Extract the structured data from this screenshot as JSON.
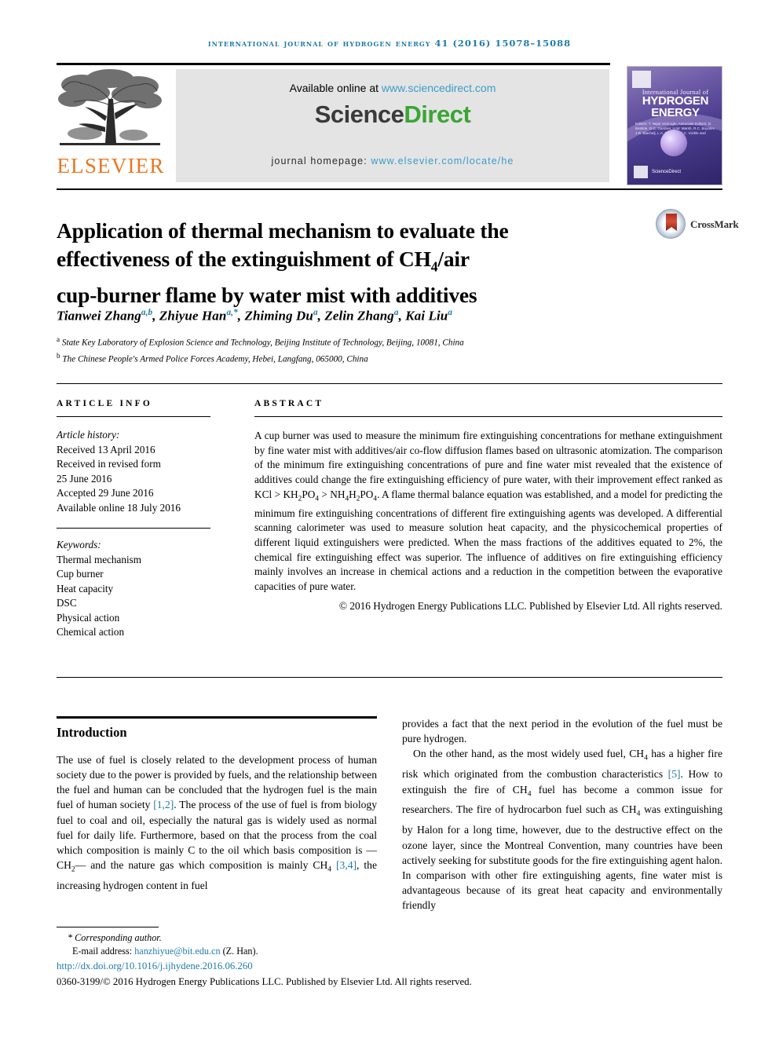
{
  "running_head": "International Journal of Hydrogen Energy 41 (2016) 15078–15088",
  "masthead": {
    "publisher": "ELSEVIER",
    "available_prefix": "Available online at ",
    "available_url": "www.sciencedirect.com",
    "logo_part1": "Science",
    "logo_part2": "Direct",
    "homepage_label": "journal homepage: ",
    "homepage_url": "www.elsevier.com/locate/he",
    "cover": {
      "line1": "International Journal of",
      "line2": "HYDROGEN ENERGY",
      "editors": "Editors: T. Nejat Veziroglu, Associate Editors: D. Bestide, D.C. Gardner, H.W. Marsh, R.C. Boyalev, J.R. Blachelj, L.A. Tho, T. and C. Vizikle and",
      "sciencedirect": "ScienceDirect"
    }
  },
  "article": {
    "title_line1": "Application of thermal mechanism to evaluate the",
    "title_line2_a": "effectiveness of the extinguishment of CH",
    "title_line2_sub": "4",
    "title_line2_b": "/air",
    "title_line3": "cup-burner flame by water mist with additives",
    "crossmark_label": "CrossMark",
    "authors": [
      {
        "name": "Tianwei Zhang",
        "marks": "a,b"
      },
      {
        "name": "Zhiyue Han",
        "marks": "a,*"
      },
      {
        "name": "Zhiming Du",
        "marks": "a"
      },
      {
        "name": "Zelin Zhang",
        "marks": "a"
      },
      {
        "name": "Kai Liu",
        "marks": "a"
      }
    ],
    "affiliations": [
      {
        "mark": "a",
        "text": "State Key Laboratory of Explosion Science and Technology, Beijing Institute of Technology, Beijing, 10081, China"
      },
      {
        "mark": "b",
        "text": "The Chinese People's Armed Police Forces Academy, Hebei, Langfang, 065000, China"
      }
    ]
  },
  "article_info": {
    "heading": "ARTICLE INFO",
    "history_label": "Article history:",
    "history": [
      "Received 13 April 2016",
      "Received in revised form",
      "25 June 2016",
      "Accepted 29 June 2016",
      "Available online 18 July 2016"
    ],
    "keywords_label": "Keywords:",
    "keywords": [
      "Thermal mechanism",
      "Cup burner",
      "Heat capacity",
      "DSC",
      "Physical action",
      "Chemical action"
    ]
  },
  "abstract": {
    "heading": "ABSTRACT",
    "part1": "A cup burner was used to measure the minimum fire extinguishing concentrations for methane extinguishment by fine water mist with additives/air co-flow diffusion flames based on ultrasonic atomization. The comparison of the minimum fire extinguishing concentrations of pure and fine water mist revealed that the existence of additives could change the fire extinguishing efficiency of pure water, with their improvement effect ranked as KCl > KH",
    "f1_sub": "2",
    "part2": "PO",
    "f2_sub": "4",
    "part3": " > NH",
    "f3_sub": "4",
    "part4": "H",
    "f4_sub": "2",
    "part5": "PO",
    "f5_sub": "4",
    "part6": ". A flame thermal balance equation was established, and a model for predicting the minimum fire extinguishing concentrations of different fire extinguishing agents was developed. A differential scanning calorimeter was used to measure solution heat capacity, and the physicochemical properties of different liquid extinguishers were predicted. When the mass fractions of the additives equated to 2%, the chemical fire extinguishing effect was superior. The influence of additives on fire extinguishing efficiency mainly involves an increase in chemical actions and a reduction in the competition between the evaporative capacities of pure water.",
    "copyright": "© 2016 Hydrogen Energy Publications LLC. Published by Elsevier Ltd. All rights reserved."
  },
  "body": {
    "intro_heading": "Introduction",
    "left_p1_a": "The use of fuel is closely related to the development process of human society due to the power is provided by fuels, and the relationship between the fuel and human can be concluded that the hydrogen fuel is the main fuel of human society ",
    "left_ref1": "[1,2]",
    "left_p1_b": ". The process of the use of fuel is from biology fuel to coal and oil, especially the natural gas is widely used as normal fuel for daily life. Furthermore, based on that the process from the coal which composition is mainly C to the oil which basis composition is —CH",
    "left_sub1": "2",
    "left_p1_c": "— and the nature gas which composition is mainly CH",
    "left_sub2": "4",
    "left_p1_d": " ",
    "left_ref2": "[3,4]",
    "left_p1_e": ", the increasing hydrogen content in fuel",
    "right_p1": "provides a fact that the next period in the evolution of the fuel must be pure hydrogen.",
    "right_p2_a": "On the other hand, as the most widely used fuel, CH",
    "right_sub1": "4",
    "right_p2_b": " has a higher fire risk which originated from the combustion characteristics ",
    "right_ref1": "[5]",
    "right_p2_c": ". How to extinguish the fire of CH",
    "right_sub2": "4",
    "right_p2_d": " fuel has become a common issue for researchers. The fire of hydrocarbon fuel such as CH",
    "right_sub3": "4",
    "right_p2_e": " was extinguishing by Halon for a long time, however, due to the destructive effect on the ozone layer, since the Montreal Convention, many countries have been actively seeking for substitute goods for the fire extinguishing agent halon. In comparison with other fire extinguishing agents, fine water mist is advantageous because of its great heat capacity and environmentally friendly"
  },
  "footnote": {
    "corresponding": "* Corresponding author.",
    "email_label": "E-mail address: ",
    "email": "hanzhiyue@bit.edu.cn",
    "email_suffix": " (Z. Han).",
    "doi": "http://dx.doi.org/10.1016/j.ijhydene.2016.06.260",
    "issn": "0360-3199/© 2016 Hydrogen Energy Publications LLC. Published by Elsevier Ltd. All rights reserved."
  },
  "colors": {
    "link": "#1f7bab",
    "elsevier_orange": "#e87722",
    "sciencedirect_green": "#3aa535"
  }
}
